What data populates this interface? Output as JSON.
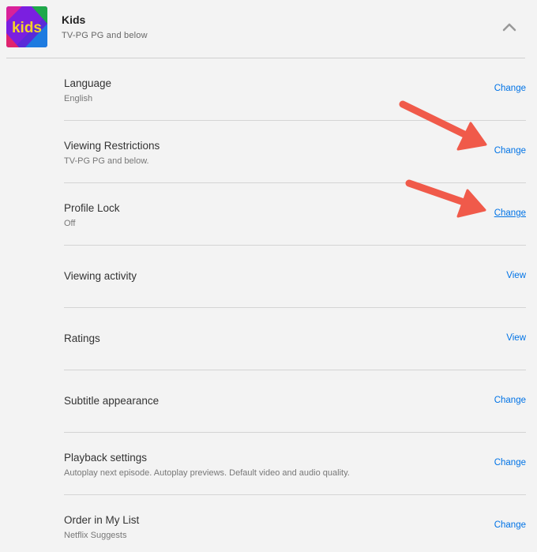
{
  "profile": {
    "name": "Kids",
    "rating": "TV-PG  PG and below",
    "avatar_text": "kids",
    "collapse_icon": "chevron-up-icon"
  },
  "settings": [
    {
      "title": "Language",
      "subtitle": "English",
      "action": "Change"
    },
    {
      "title": "Viewing Restrictions",
      "subtitle": "TV-PG  PG and below.",
      "action": "Change"
    },
    {
      "title": "Profile Lock",
      "subtitle": "Off",
      "action": "Change"
    },
    {
      "title": "Viewing activity",
      "subtitle": "",
      "action": "View"
    },
    {
      "title": "Ratings",
      "subtitle": "",
      "action": "View"
    },
    {
      "title": "Subtitle appearance",
      "subtitle": "",
      "action": "Change"
    },
    {
      "title": "Playback settings",
      "subtitle": "Autoplay next episode. Autoplay previews. Default video and audio quality.",
      "action": "Change"
    },
    {
      "title": "Order in My List",
      "subtitle": "Netflix Suggests",
      "action": "Change"
    }
  ],
  "colors": {
    "link": "#0073e6",
    "annotation_arrow": "#f05a4a",
    "avatar_text": "#f5d328"
  }
}
